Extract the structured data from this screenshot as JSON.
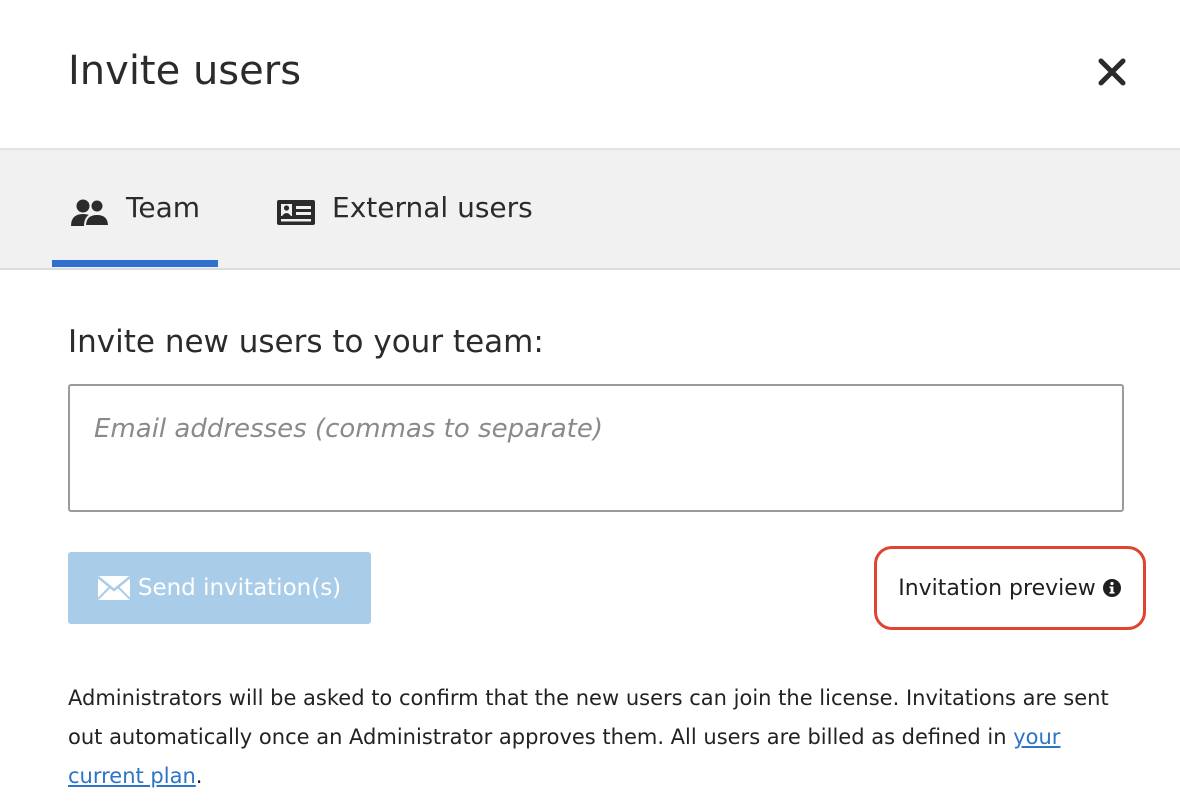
{
  "dialog": {
    "title": "Invite users",
    "close_icon": "close-icon"
  },
  "tabs": [
    {
      "label": "Team",
      "icon": "team-icon",
      "active": true
    },
    {
      "label": "External users",
      "icon": "id-card-icon",
      "active": false
    }
  ],
  "invite": {
    "label": "Invite new users to your team:",
    "email_value": "",
    "email_placeholder": "Email addresses (commas to separate)"
  },
  "actions": {
    "send_label": "Send invitation(s)",
    "send_icon": "envelope-icon",
    "send_enabled": false,
    "preview_label": "Invitation preview",
    "preview_icon": "info-icon"
  },
  "footnote": {
    "text": "Administrators will be asked to confirm that the new users can join the license. Invitations are sent out automatically once an Administrator approves them. All users are billed as defined in ",
    "link_text": "your current plan",
    "suffix": "."
  },
  "colors": {
    "accent": "#2f6fd0",
    "send_button_disabled": "#a9cce8",
    "highlight_border": "#e0432f",
    "link": "#2b74c8",
    "tabs_background": "#f1f1f1"
  }
}
